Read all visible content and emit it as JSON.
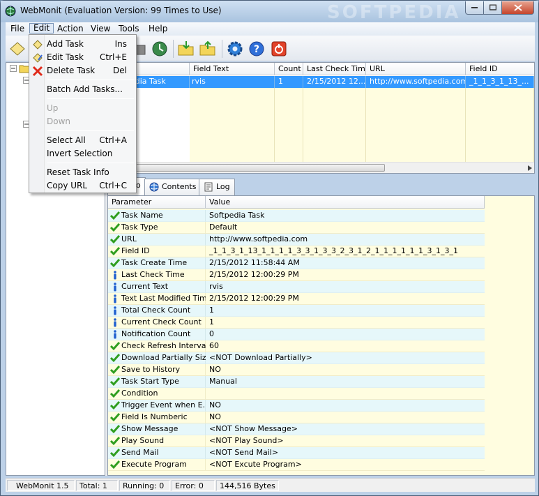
{
  "window": {
    "title": "WebMonit (Evaluation Version: 99 Times to Use)",
    "watermark": "SOFTPEDIA"
  },
  "menubar": [
    {
      "label": "File"
    },
    {
      "label": "Edit"
    },
    {
      "label": "Action"
    },
    {
      "label": "View"
    },
    {
      "label": "Tools"
    },
    {
      "label": "Help"
    }
  ],
  "edit_menu": {
    "add_task": {
      "label": "Add Task",
      "shortcut": "Ins"
    },
    "edit_task": {
      "label": "Edit Task",
      "shortcut": "Ctrl+E"
    },
    "delete_task": {
      "label": "Delete Task",
      "shortcut": "Del"
    },
    "batch_add": {
      "label": "Batch Add Tasks..."
    },
    "up": {
      "label": "Up"
    },
    "down": {
      "label": "Down"
    },
    "select_all": {
      "label": "Select All",
      "shortcut": "Ctrl+A"
    },
    "invert_selection": {
      "label": "Invert Selection"
    },
    "reset_task_info": {
      "label": "Reset Task Info"
    },
    "copy_url": {
      "label": "Copy URL",
      "shortcut": "Ctrl+C"
    }
  },
  "task_table": {
    "columns": [
      "Field Text",
      "Count",
      "Last Check Time",
      "URL",
      "Field ID"
    ],
    "row": {
      "name": "edia Task",
      "field_text": "rvis",
      "count": "1",
      "last_check": "2/15/2012 12...",
      "url": "http://www.softpedia.com",
      "field_id": "_1_1_3_1_13_..."
    }
  },
  "tabs": [
    {
      "label": "o"
    },
    {
      "label": "Contents"
    },
    {
      "label": "Log"
    }
  ],
  "param_table": {
    "headers": {
      "parameter": "Parameter",
      "value": "Value"
    },
    "rows": [
      {
        "name": "Task Name",
        "value": "Softpedia Task",
        "icon": "check-icon"
      },
      {
        "name": "Task Type",
        "value": "Default",
        "icon": "check-icon"
      },
      {
        "name": "URL",
        "value": "http://www.softpedia.com",
        "icon": "check-icon"
      },
      {
        "name": "Field ID",
        "value": "_1_1_3_1_13_1_1_1_1_3_3_1_3_3_2_3_1_2_1_1_1_1_1_1_3_1_3_1",
        "icon": "check-icon"
      },
      {
        "name": "Task Create Time",
        "value": "2/15/2012 11:58:44 AM",
        "icon": "check-icon"
      },
      {
        "name": "Last Check Time",
        "value": "2/15/2012 12:00:29 PM",
        "icon": "info-icon"
      },
      {
        "name": "Current Text",
        "value": "rvis",
        "icon": "info-icon"
      },
      {
        "name": "Text Last Modified Time",
        "value": "2/15/2012 12:00:29 PM",
        "icon": "info-icon"
      },
      {
        "name": "Total Check Count",
        "value": "1",
        "icon": "info-icon"
      },
      {
        "name": "Current Check Count",
        "value": "1",
        "icon": "info-icon"
      },
      {
        "name": "Notification Count",
        "value": "0",
        "icon": "info-icon"
      },
      {
        "name": "Check Refresh Interval",
        "value": "60",
        "icon": "check-icon"
      },
      {
        "name": "Download Partially Size",
        "value": "<NOT Download Partially>",
        "icon": "check-icon"
      },
      {
        "name": "Save to History",
        "value": "NO",
        "icon": "check-icon"
      },
      {
        "name": "Task Start Type",
        "value": "Manual",
        "icon": "check-icon"
      },
      {
        "name": "Condition",
        "value": "",
        "icon": "check-icon"
      },
      {
        "name": "Trigger Event when E...",
        "value": "NO",
        "icon": "check-icon"
      },
      {
        "name": "Field Is Numberic",
        "value": "NO",
        "icon": "check-icon"
      },
      {
        "name": "Show Message",
        "value": "<NOT Show Message>",
        "icon": "check-icon"
      },
      {
        "name": "Play Sound",
        "value": "<NOT Play Sound>",
        "icon": "check-icon"
      },
      {
        "name": "Send Mail",
        "value": "<NOT Send Mail>",
        "icon": "check-icon"
      },
      {
        "name": "Execute Program",
        "value": "<NOT Excute Program>",
        "icon": "check-icon"
      }
    ]
  },
  "statusbar": {
    "version": "WebMonit 1.5",
    "total": "Total: 1",
    "running": "Running: 0",
    "error": "Error: 0",
    "bytes": "144,516 Bytes"
  },
  "colors": {
    "selection": "#3399ff",
    "check_green": "#2f9e1f",
    "info_blue": "#1f5fcf"
  }
}
